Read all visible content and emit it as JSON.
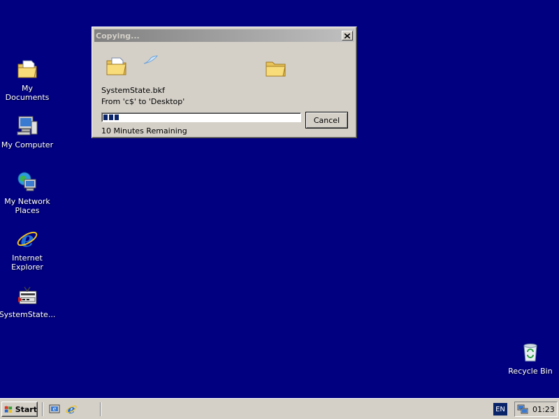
{
  "desktop": {
    "background_color": "#000080",
    "icons": [
      {
        "label": "My Documents",
        "icon": "my-documents-icon"
      },
      {
        "label": "My Computer",
        "icon": "my-computer-icon"
      },
      {
        "label": "My Network\nPlaces",
        "icon": "network-places-icon"
      },
      {
        "label": "Internet\nExplorer",
        "icon": "internet-explorer-icon"
      },
      {
        "label": "SystemState...",
        "icon": "backup-file-icon"
      },
      {
        "label": "Recycle Bin",
        "icon": "recycle-bin-icon"
      }
    ]
  },
  "dialog": {
    "title": "Copying...",
    "file_name": "SystemState.bkf",
    "from_to": "From 'c$' to 'Desktop'",
    "progress_fraction": 0.08,
    "time_remaining": "10 Minutes Remaining",
    "cancel_label": "Cancel"
  },
  "taskbar": {
    "start_label": "Start",
    "quick_launch": [
      "show-desktop-icon",
      "internet-explorer-icon"
    ],
    "language": "EN",
    "clock": "01:23"
  }
}
